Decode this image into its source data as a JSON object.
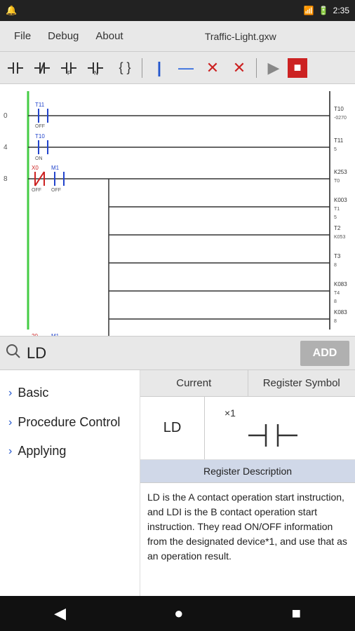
{
  "status_bar": {
    "time": "2:35",
    "signal_icon": "📶",
    "battery_icon": "🔋"
  },
  "menu": {
    "file": "File",
    "debug": "Debug",
    "about": "About",
    "title": "Traffic-Light.gxw"
  },
  "toolbar": {
    "buttons": [
      {
        "name": "contact-no",
        "label": "⊣⊢"
      },
      {
        "name": "contact-nc",
        "label": "⊣/⊢"
      },
      {
        "name": "contact-p",
        "label": "⊣↑⊢"
      },
      {
        "name": "contact-n",
        "label": "⊣↓⊢"
      },
      {
        "name": "bracket",
        "label": "{}"
      },
      {
        "name": "vertical-line",
        "label": "|"
      },
      {
        "name": "horizontal-line",
        "label": "—"
      },
      {
        "name": "delete-contact",
        "label": "✕"
      },
      {
        "name": "delete-coil",
        "label": "✕"
      },
      {
        "name": "play",
        "label": "▶"
      },
      {
        "name": "stop",
        "label": "■"
      }
    ]
  },
  "search": {
    "value": "LD",
    "placeholder": "LD",
    "add_button": "ADD"
  },
  "nav": {
    "items": [
      {
        "id": "basic",
        "label": "Basic"
      },
      {
        "id": "procedure-control",
        "label": "Procedure Control"
      },
      {
        "id": "applying",
        "label": "Applying"
      }
    ]
  },
  "table": {
    "headers": [
      "Current",
      "Register Symbol"
    ],
    "rows": [
      {
        "current": "LD",
        "symbol_x": "×1",
        "symbol_desc": "contact"
      }
    ]
  },
  "register_description": {
    "header": "Register Description",
    "body": "LD is the A contact operation start instruction, and LDI is the B contact operation start instruction. They read ON/OFF information from the designated device*1, and use that as an operation result."
  },
  "nav_bar": {
    "back": "◀",
    "home": "●",
    "recent": "■"
  }
}
